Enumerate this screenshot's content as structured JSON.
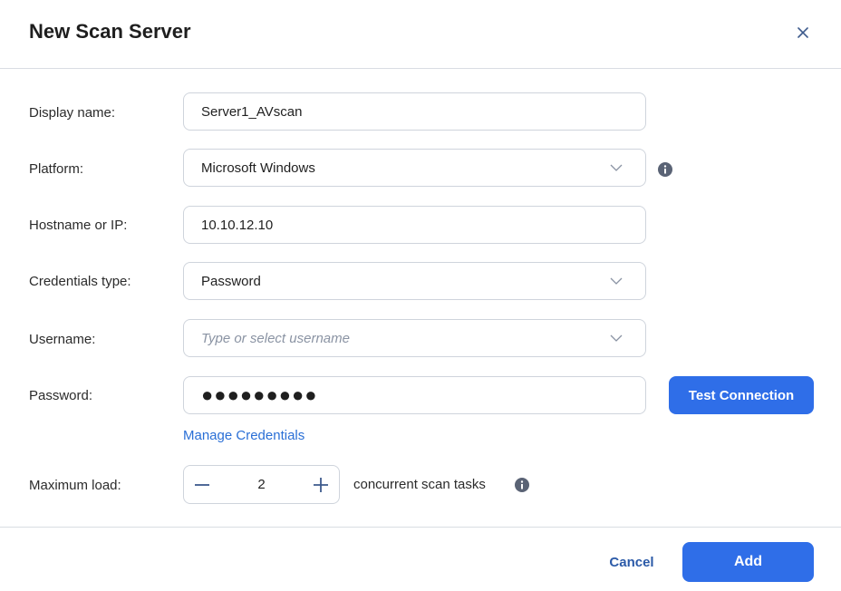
{
  "dialog": {
    "title": "New Scan Server",
    "close_icon": "close-icon"
  },
  "form": {
    "display_name": {
      "label": "Display name:",
      "value": "Server1_AVscan"
    },
    "platform": {
      "label": "Platform:",
      "value": "Microsoft Windows",
      "info_icon": "info-icon"
    },
    "hostname": {
      "label": "Hostname or IP:",
      "value": "10.10.12.10"
    },
    "credentials_type": {
      "label": "Credentials type:",
      "value": "Password"
    },
    "username": {
      "label": "Username:",
      "placeholder": "Type or select username"
    },
    "password": {
      "label": "Password:",
      "value": "●●●●●●●●●"
    },
    "test_connection_label": "Test Connection",
    "manage_credentials_label": "Manage Credentials",
    "maximum_load": {
      "label": "Maximum load:",
      "value": "2",
      "suffix": "concurrent scan tasks",
      "info_icon": "info-icon"
    }
  },
  "footer": {
    "cancel_label": "Cancel",
    "add_label": "Add"
  },
  "colors": {
    "primary": "#2f6ee8",
    "link": "#2a6fd6",
    "border": "#cfd4dc",
    "icon": "#5a6375"
  }
}
